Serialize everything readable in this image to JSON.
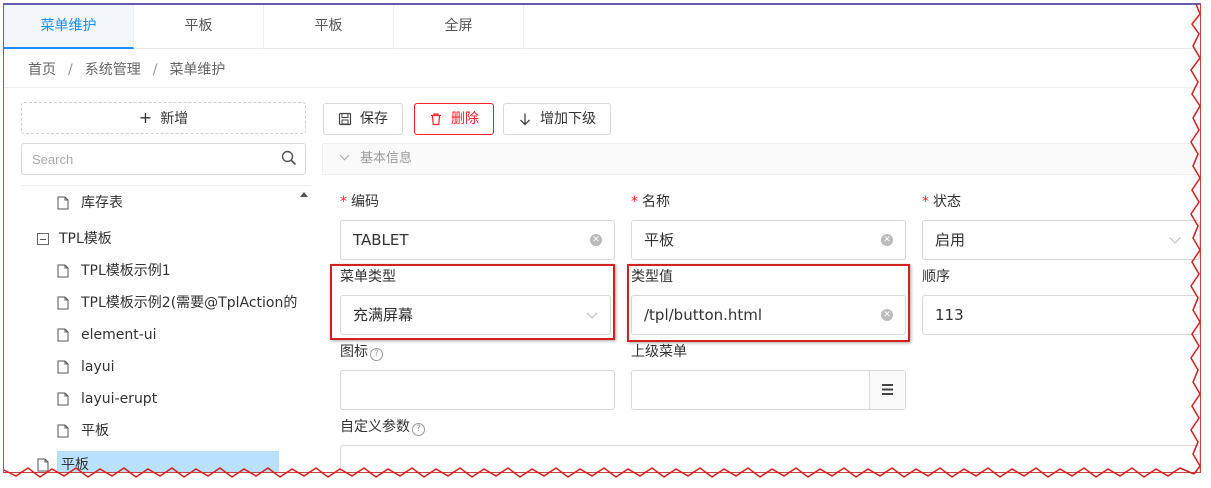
{
  "tabs": [
    {
      "label": "菜单维护",
      "active": true
    },
    {
      "label": "平板",
      "active": false
    },
    {
      "label": "平板",
      "active": false
    },
    {
      "label": "全屏",
      "active": false
    }
  ],
  "breadcrumb": [
    "首页",
    "系统管理",
    "菜单维护"
  ],
  "sidebar": {
    "add_label": "新增",
    "search_placeholder": "Search",
    "tree": [
      {
        "label": "库存表",
        "type": "leaf"
      },
      {
        "label": "TPL模板",
        "type": "folder-expanded"
      },
      {
        "label": "TPL模板示例1",
        "type": "leaf"
      },
      {
        "label": "TPL模板示例2(需要@TplAction的",
        "type": "leaf"
      },
      {
        "label": "element-ui",
        "type": "leaf"
      },
      {
        "label": "layui",
        "type": "leaf"
      },
      {
        "label": "layui-erupt",
        "type": "leaf"
      },
      {
        "label": "平板",
        "type": "leaf"
      },
      {
        "label": "平板",
        "type": "leaf-selected"
      }
    ]
  },
  "toolbar": {
    "save_label": "保存",
    "delete_label": "删除",
    "add_child_label": "增加下级"
  },
  "panel": {
    "title": "基本信息"
  },
  "form": {
    "code_label": "编码",
    "code_value": "TABLET",
    "name_label": "名称",
    "name_value": "平板",
    "status_label": "状态",
    "status_value": "启用",
    "type_label": "菜单类型",
    "type_value": "充满屏幕",
    "type_value_label": "类型值",
    "type_value_value": "/tpl/button.html",
    "order_label": "顺序",
    "order_value": "113",
    "icon_label": "图标",
    "parent_label": "上级菜单",
    "params_label": "自定义参数"
  },
  "colors": {
    "accent": "#1890ff",
    "danger": "#f5222d",
    "highlight": "#d32020",
    "selected": "#bae0ff"
  }
}
